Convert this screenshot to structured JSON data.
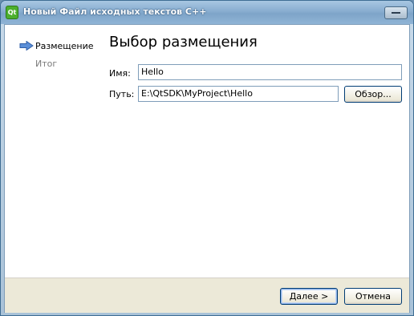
{
  "window": {
    "title": "Новый Файл исходных текстов С++",
    "icon_text": "Qt"
  },
  "sidebar": {
    "items": [
      {
        "label": "Размещение",
        "state": "active"
      },
      {
        "label": "Итог",
        "state": "inactive"
      }
    ]
  },
  "main": {
    "title": "Выбор размещения",
    "name_label": "Имя:",
    "name_value": "Hello",
    "path_label": "Путь:",
    "path_value": "E:\\QtSDK\\MyProject\\Hello",
    "browse_label": "Обзор..."
  },
  "footer": {
    "next_mnemonic": "Д",
    "next_rest": "алее >",
    "cancel_label": "Отмена"
  },
  "colors": {
    "accent": "#3f7fcf",
    "inactive_text": "#7a7a7a"
  }
}
